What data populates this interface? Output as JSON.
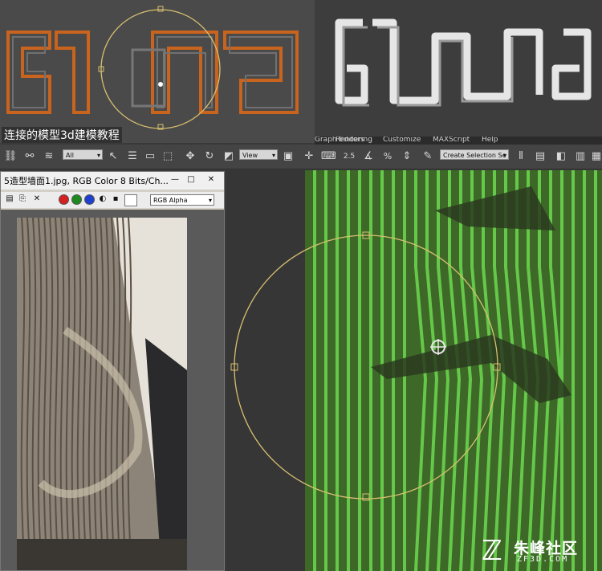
{
  "tutorial": {
    "title": "连接的模型3d建模教程"
  },
  "menu": {
    "items": [
      "Graph Editors",
      "Rendering",
      "Customize",
      "MAXScript",
      "Help"
    ]
  },
  "toolbar": {
    "selection_filter": "All",
    "reference_coord": "View",
    "named_selection": "Create Selection Se",
    "snap_value": "2.5",
    "icons": [
      "link-icon",
      "unlink-icon",
      "bind-space-warp-icon",
      "select-icon",
      "select-by-name-icon",
      "rect-region-icon",
      "window-crossing-icon",
      "move-icon",
      "rotate-icon",
      "scale-icon",
      "pivot-icon",
      "select-manipulate-icon",
      "keyboard-shortcut-icon",
      "snap-toggle-icon",
      "angle-snap-icon",
      "percent-snap-icon",
      "spinner-snap-icon",
      "edit-named-selection-icon",
      "mirror-icon",
      "align-icon",
      "layer-icon",
      "graphite-icon",
      "curve-editor-icon"
    ]
  },
  "frame_window": {
    "title": "5造型墙面1.jpg, RGB Color 8 Bits/Ch...",
    "channel": "RGB Alpha",
    "channel_colors": [
      "#d42020",
      "#1e8a1e",
      "#1f3fcf"
    ]
  },
  "viewport": {
    "stripe_color": "#66c84a",
    "background_color": "#3f6a28",
    "gizmo_color": "#e0c878"
  },
  "watermark": {
    "name": "朱峰社区",
    "url": "ZF3D.COM"
  },
  "colors": {
    "ui_dark": "#444444",
    "accent_orange": "#d2691e"
  }
}
